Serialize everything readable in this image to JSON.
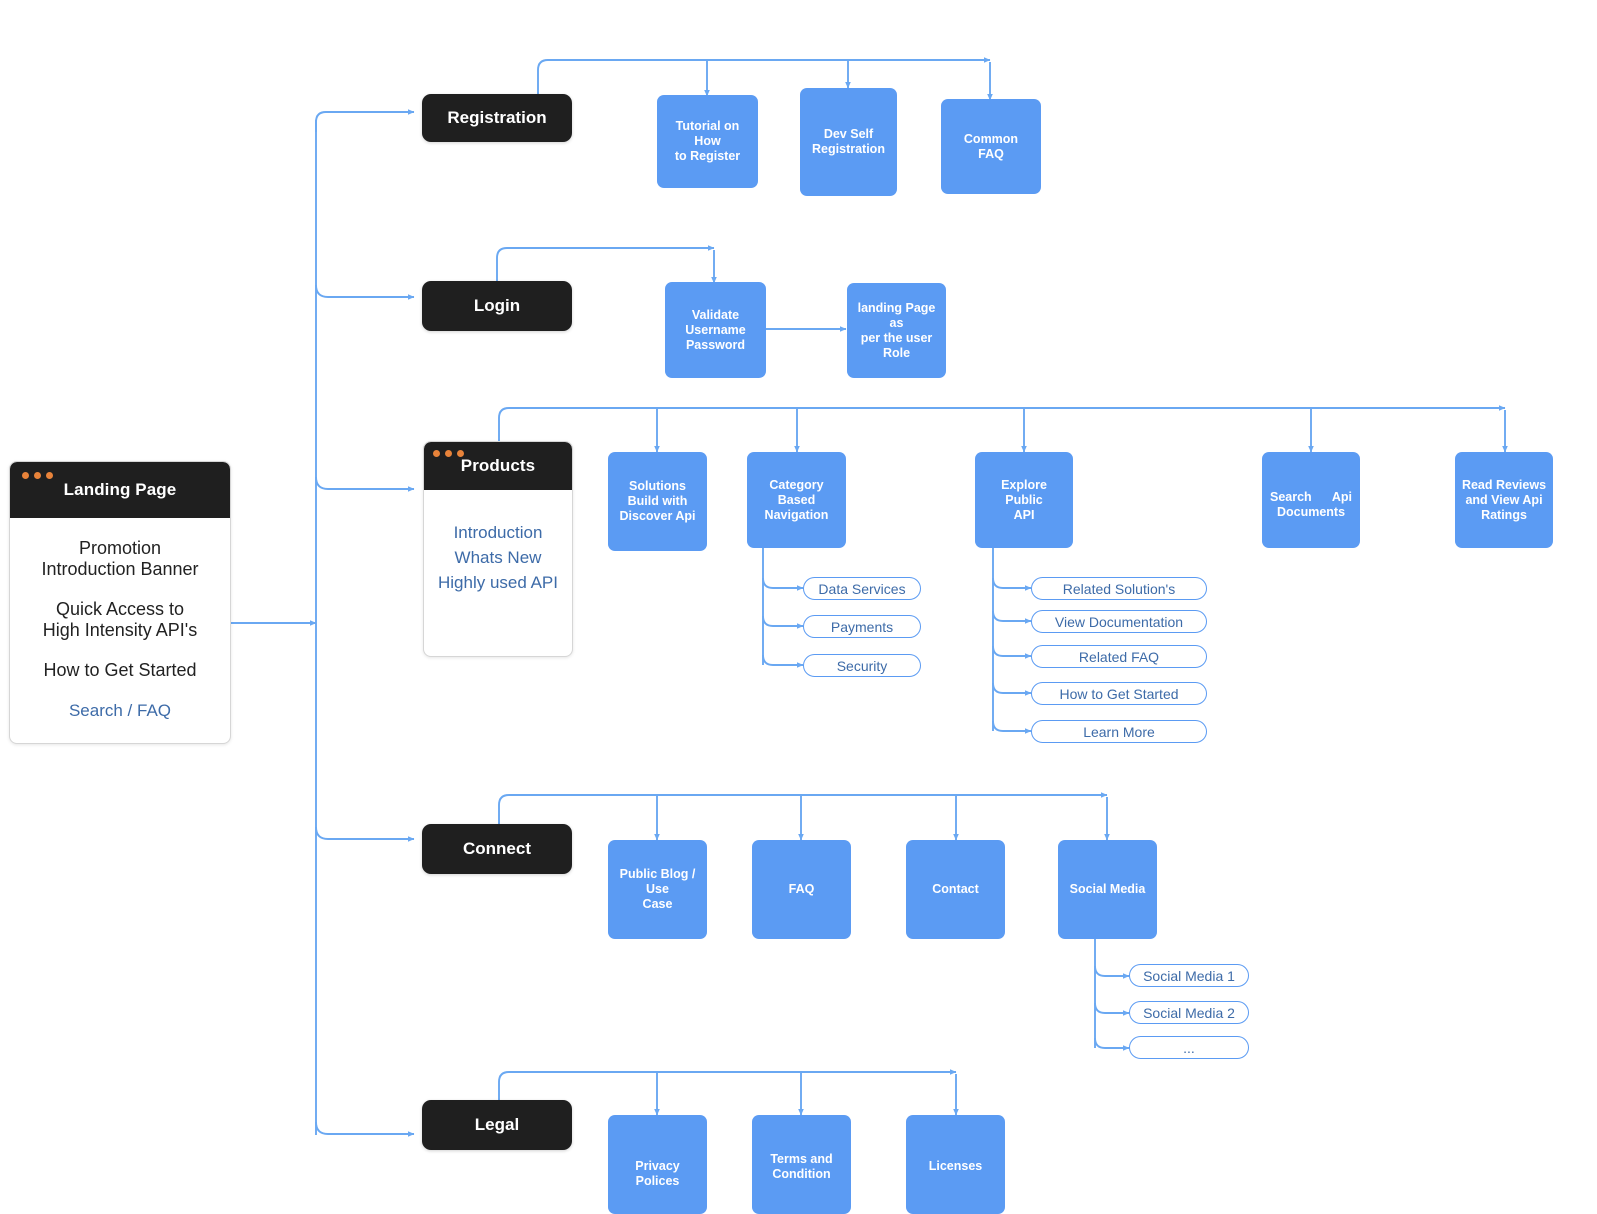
{
  "colors": {
    "blue": "#5b9bf3",
    "dark": "#1f1f1f",
    "link": "#3d6ba8",
    "dot": "#e8833a",
    "wire": "#6aa8f2"
  },
  "landing_window": {
    "title": "Landing Page",
    "lines": [
      "Promotion",
      "Introduction Banner",
      "Quick Access to",
      "High Intensity API's",
      "How to Get Started"
    ],
    "link": "Search / FAQ"
  },
  "products_window": {
    "title": "Products",
    "links": [
      "Introduction",
      "Whats New",
      "Highly used API"
    ]
  },
  "sections": {
    "registration": {
      "header": "Registration",
      "children": [
        {
          "line1": "Tutorial on How",
          "line2": "to Register"
        },
        {
          "line1": "Dev Self",
          "line2": "Registration"
        },
        {
          "line1": "Common",
          "line2": "FAQ"
        }
      ]
    },
    "login": {
      "header": "Login",
      "children": [
        {
          "line1": "Validate",
          "line2": "Username",
          "line3": "Password"
        },
        {
          "line1": "landing Page as",
          "line2": "per the user Role"
        }
      ]
    },
    "products": {
      "header": "Products",
      "children": [
        {
          "line1": "Solutions",
          "line2": "Build with",
          "line3": "Discover Api"
        },
        {
          "line1": "Category Based",
          "line2": "Navigation"
        },
        {
          "line1": "Explore Public",
          "line2": "API"
        },
        {
          "line1": "Search",
          "line1b": "Api",
          "line2": "Documents"
        },
        {
          "line1": "Read Reviews",
          "line2": "and View Api",
          "line3": "Ratings"
        }
      ],
      "category_pills": [
        "Data Services",
        "Payments",
        "Security"
      ],
      "explore_pills": [
        "Related Solution's",
        "View Documentation",
        "Related FAQ",
        "How to Get Started",
        "Learn More"
      ]
    },
    "connect": {
      "header": "Connect",
      "children": [
        {
          "line1": "Public Blog / Use",
          "line2": "Case"
        },
        {
          "line1": "FAQ"
        },
        {
          "line1": "Contact"
        },
        {
          "line1": "Social Media"
        }
      ],
      "social_pills": [
        "Social Media 1",
        "Social Media 2",
        "..."
      ]
    },
    "legal": {
      "header": "Legal",
      "children": [
        {
          "line1": "Privacy Polices"
        },
        {
          "line1": "Terms and",
          "line2": "Condition"
        },
        {
          "line1": "Licenses"
        }
      ]
    }
  }
}
